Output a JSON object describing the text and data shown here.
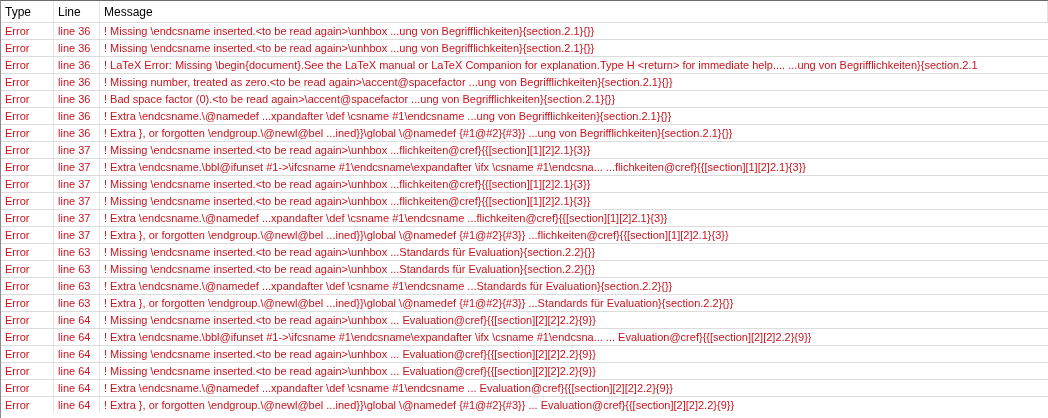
{
  "table": {
    "columns": [
      "Type",
      "Line",
      "Message"
    ],
    "rows": [
      {
        "type": "Error",
        "line": "line 36",
        "message": "! Missing \\endcsname inserted.<to be read again>\\unhbox ...ung von Begrifflichkeiten}{section.2.1}{}}"
      },
      {
        "type": "Error",
        "line": "line 36",
        "message": "! Missing \\endcsname inserted.<to be read again>\\unhbox ...ung von Begrifflichkeiten}{section.2.1}{}}"
      },
      {
        "type": "Error",
        "line": "line 36",
        "message": "! LaTeX Error: Missing \\begin{document}.See the LaTeX manual or LaTeX Companion for explanation.Type H <return> for immediate help.... ...ung von Begrifflichkeiten}{section.2.1"
      },
      {
        "type": "Error",
        "line": "line 36",
        "message": "! Missing number, treated as zero.<to be read again>\\accent@spacefactor ...ung von Begrifflichkeiten}{section.2.1}{}}"
      },
      {
        "type": "Error",
        "line": "line 36",
        "message": "! Bad space factor (0).<to be read again>\\accent@spacefactor ...ung von Begrifflichkeiten}{section.2.1}{}}"
      },
      {
        "type": "Error",
        "line": "line 36",
        "message": "! Extra \\endcsname.\\@namedef ...xpandafter \\def \\csname #1\\endcsname ...ung von Begrifflichkeiten}{section.2.1}{}}"
      },
      {
        "type": "Error",
        "line": "line 36",
        "message": "! Extra }, or forgotten \\endgroup.\\@newl@bel ...ined}}\\global \\@namedef {#1@#2}{#3}} ...ung von Begrifflichkeiten}{section.2.1}{}}"
      },
      {
        "type": "Error",
        "line": "line 37",
        "message": "! Missing \\endcsname inserted.<to be read again>\\unhbox ...flichkeiten@cref}{{[section][1][2]2.1}{3}}"
      },
      {
        "type": "Error",
        "line": "line 37",
        "message": "! Extra \\endcsname.\\bbl@ifunset #1->\\ifcsname #1\\endcsname\\expandafter \\ifx \\csname #1\\endcsna... ...flichkeiten@cref}{{[section][1][2]2.1}{3}}"
      },
      {
        "type": "Error",
        "line": "line 37",
        "message": "! Missing \\endcsname inserted.<to be read again>\\unhbox ...flichkeiten@cref}{{[section][1][2]2.1}{3}}"
      },
      {
        "type": "Error",
        "line": "line 37",
        "message": "! Missing \\endcsname inserted.<to be read again>\\unhbox ...flichkeiten@cref}{{[section][1][2]2.1}{3}}"
      },
      {
        "type": "Error",
        "line": "line 37",
        "message": "! Extra \\endcsname.\\@namedef ...xpandafter \\def \\csname #1\\endcsname ...flichkeiten@cref}{{[section][1][2]2.1}{3}}"
      },
      {
        "type": "Error",
        "line": "line 37",
        "message": "! Extra }, or forgotten \\endgroup.\\@newl@bel ...ined}}\\global \\@namedef {#1@#2}{#3}} ...flichkeiten@cref}{{[section][1][2]2.1}{3}}"
      },
      {
        "type": "Error",
        "line": "line 63",
        "message": "! Missing \\endcsname inserted.<to be read again>\\unhbox ...Standards für Evaluation}{section.2.2}{}}"
      },
      {
        "type": "Error",
        "line": "line 63",
        "message": "! Missing \\endcsname inserted.<to be read again>\\unhbox ...Standards für Evaluation}{section.2.2}{}}"
      },
      {
        "type": "Error",
        "line": "line 63",
        "message": "! Extra \\endcsname.\\@namedef ...xpandafter \\def \\csname #1\\endcsname ...Standards für Evaluation}{section.2.2}{}}"
      },
      {
        "type": "Error",
        "line": "line 63",
        "message": "! Extra }, or forgotten \\endgroup.\\@newl@bel ...ined}}\\global \\@namedef {#1@#2}{#3}} ...Standards für Evaluation}{section.2.2}{}}"
      },
      {
        "type": "Error",
        "line": "line 64",
        "message": "! Missing \\endcsname inserted.<to be read again>\\unhbox ... Evaluation@cref}{{[section][2][2]2.2}{9}}"
      },
      {
        "type": "Error",
        "line": "line 64",
        "message": "! Extra \\endcsname.\\bbl@ifunset #1->\\ifcsname #1\\endcsname\\expandafter \\ifx \\csname #1\\endcsna... ... Evaluation@cref}{{[section][2][2]2.2}{9}}"
      },
      {
        "type": "Error",
        "line": "line 64",
        "message": "! Missing \\endcsname inserted.<to be read again>\\unhbox ... Evaluation@cref}{{[section][2][2]2.2}{9}}"
      },
      {
        "type": "Error",
        "line": "line 64",
        "message": "! Missing \\endcsname inserted.<to be read again>\\unhbox ... Evaluation@cref}{{[section][2][2]2.2}{9}}"
      },
      {
        "type": "Error",
        "line": "line 64",
        "message": "! Extra \\endcsname.\\@namedef ...xpandafter \\def \\csname #1\\endcsname ... Evaluation@cref}{{[section][2][2]2.2}{9}}"
      },
      {
        "type": "Error",
        "line": "line 64",
        "message": "! Extra }, or forgotten \\endgroup.\\@newl@bel ...ined}}\\global \\@namedef {#1@#2}{#3}} ... Evaluation@cref}{{[section][2][2]2.2}{9}}"
      }
    ]
  }
}
